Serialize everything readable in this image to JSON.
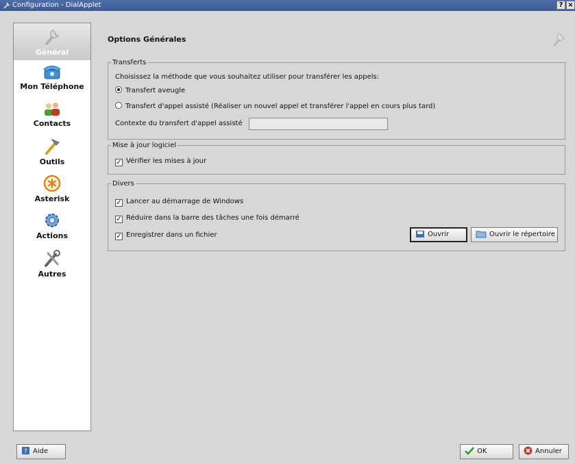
{
  "window": {
    "title": "Configuration - DialApplet",
    "help_label": "?",
    "close_label": "×"
  },
  "sidebar": {
    "items": [
      {
        "label": "Général",
        "icon": "wrench-icon",
        "selected": true
      },
      {
        "label": "Mon Téléphone",
        "icon": "telephone-icon"
      },
      {
        "label": "Contacts",
        "icon": "contacts-icon"
      },
      {
        "label": "Outils",
        "icon": "tools-icon"
      },
      {
        "label": "Asterisk",
        "icon": "asterisk-icon"
      },
      {
        "label": "Actions",
        "icon": "actions-gear-icon"
      },
      {
        "label": "Autres",
        "icon": "other-tools-icon"
      }
    ]
  },
  "main": {
    "title": "Options Générales",
    "transferts": {
      "legend": "Transferts",
      "question": "Choisissez la méthode que vous souhaitez utiliser pour transférer les appels:",
      "option_aveugle": "Transfert aveugle",
      "option_assiste": "Transfert d'appel assisté (Réaliser un nouvel appel et transférer l'appel en cours plus tard)",
      "selected": "aveugle",
      "context_label": "Contexte du transfert d'appel assisté",
      "context_value": ""
    },
    "maj": {
      "legend": "Mise à jour logiciel",
      "check_updates": "Vérifier les mises à jour",
      "check_updates_checked": true
    },
    "divers": {
      "legend": "Divers",
      "launch_startup": "Lancer au démarrage de Windows",
      "launch_startup_checked": true,
      "minimize_tray": "Réduire dans la barre des tâches une fois démarré",
      "minimize_tray_checked": true,
      "save_file": "Enregistrer dans un fichier",
      "save_file_checked": true,
      "open_button": "Ouvrir",
      "open_dir_button": "Ouvrir le répertoire"
    }
  },
  "footer": {
    "help_button": "Aide",
    "ok_button": "OK",
    "cancel_button": "Annuler"
  },
  "colors": {
    "accent_selected": "#c9c9c9",
    "ok_green": "#2a9d2a",
    "cancel_red": "#c0392b",
    "floppy_blue": "#3b6fb6"
  }
}
